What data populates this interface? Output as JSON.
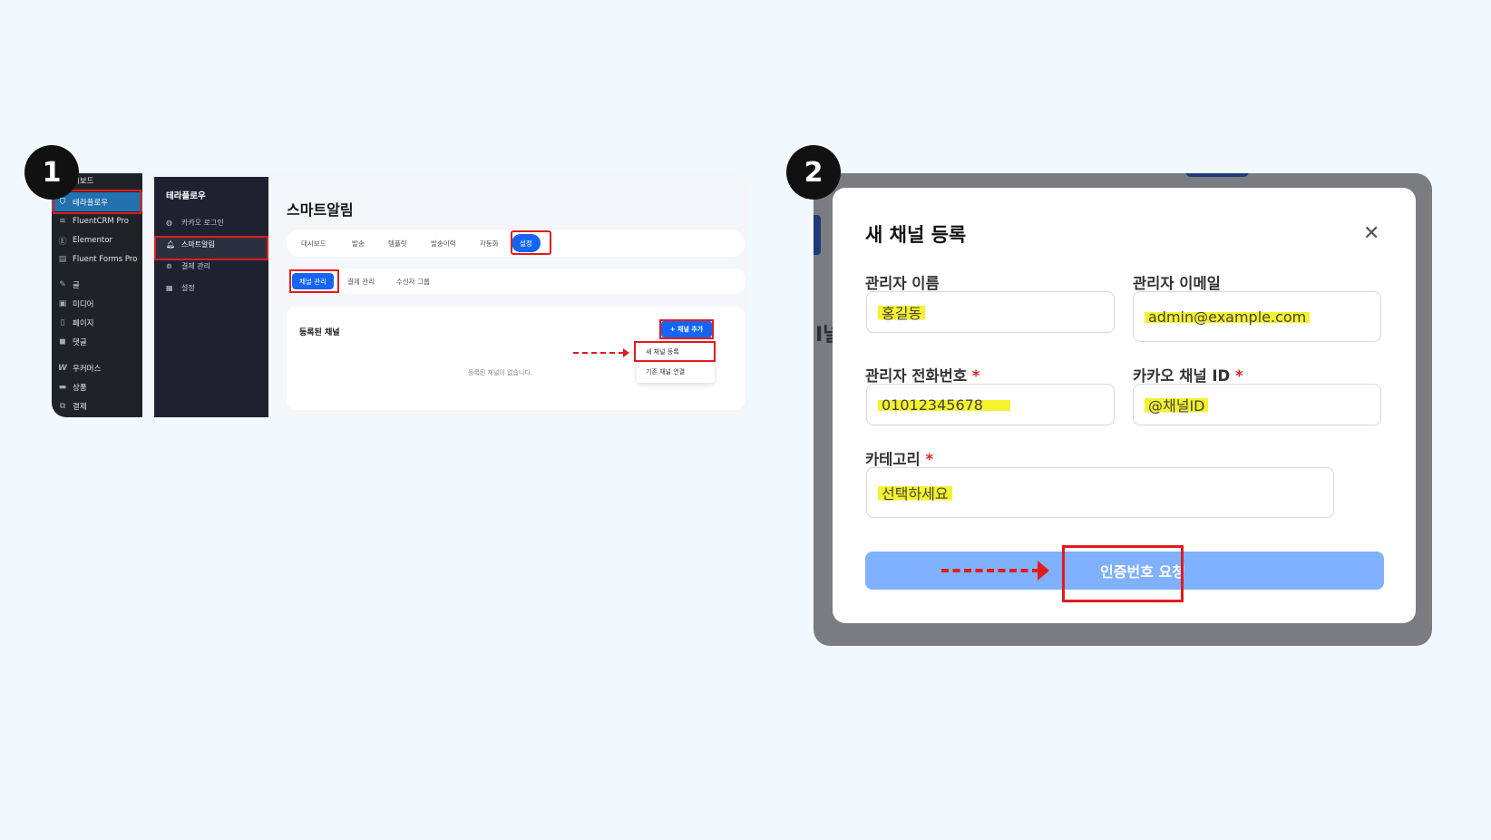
{
  "steps": {
    "one": "1",
    "two": "2"
  },
  "wp_sidebar": {
    "items": [
      {
        "label": "시보드",
        "icon": "dashboard-icon"
      },
      {
        "label": "테라플로우",
        "icon": "shield-icon",
        "active": true
      },
      {
        "label": "FluentCRM Pro",
        "icon": "flag-icon"
      },
      {
        "label": "Elementor",
        "icon": "elementor-icon"
      },
      {
        "label": "Fluent Forms Pro",
        "icon": "form-icon"
      },
      {
        "label": "글",
        "icon": "pin-icon"
      },
      {
        "label": "미디어",
        "icon": "media-icon"
      },
      {
        "label": "페이지",
        "icon": "page-icon"
      },
      {
        "label": "댓글",
        "icon": "comment-icon"
      },
      {
        "label": "우커머스",
        "icon": "woo-icon"
      },
      {
        "label": "상품",
        "icon": "product-icon"
      },
      {
        "label": "결제",
        "icon": "payment-icon"
      }
    ]
  },
  "plugin_sidebar": {
    "title": "테라플로우",
    "items": [
      {
        "label": "카카오 로그인",
        "icon": "globe-icon"
      },
      {
        "label": "스마트알림",
        "icon": "bell-icon",
        "active": true
      },
      {
        "label": "결제 관리",
        "icon": "coin-icon"
      },
      {
        "label": "설정",
        "icon": "grid-icon"
      }
    ]
  },
  "main1": {
    "page_title": "스마트알림",
    "tabs": [
      "대시보드",
      "발송",
      "템플릿",
      "발송이력",
      "자동화",
      "설정"
    ],
    "subtabs": [
      "채널 관리",
      "결제 관리",
      "수신자 그룹"
    ],
    "card_title": "등록된 채널",
    "add_button": "+ 채널 추가",
    "empty_text": "등록된 채널이 없습니다.",
    "dropdown": [
      "새 채널 등록",
      "기존 채널 연결"
    ]
  },
  "modal": {
    "background_text": "I널",
    "title": "새 채널 등록",
    "close": "✕",
    "fields": {
      "admin_name": {
        "label": "관리자 이름",
        "value": "홍길동"
      },
      "admin_email": {
        "label": "관리자 이메일",
        "value": "admin@example.com"
      },
      "admin_phone": {
        "label": "관리자 전화번호",
        "required": "*",
        "value": "01012345678"
      },
      "kakao_id": {
        "label": "카카오 채널 ID",
        "required": "*",
        "value": "@채널ID"
      },
      "category": {
        "label": "카테고리",
        "required": "*",
        "value": "선택하세요"
      }
    },
    "submit": "인증번호 요청"
  },
  "colors": {
    "primary": "#1565f5",
    "highlight_box": "#e31b1b",
    "marker": "#f5f22e",
    "button_light": "#7fb1ff"
  }
}
